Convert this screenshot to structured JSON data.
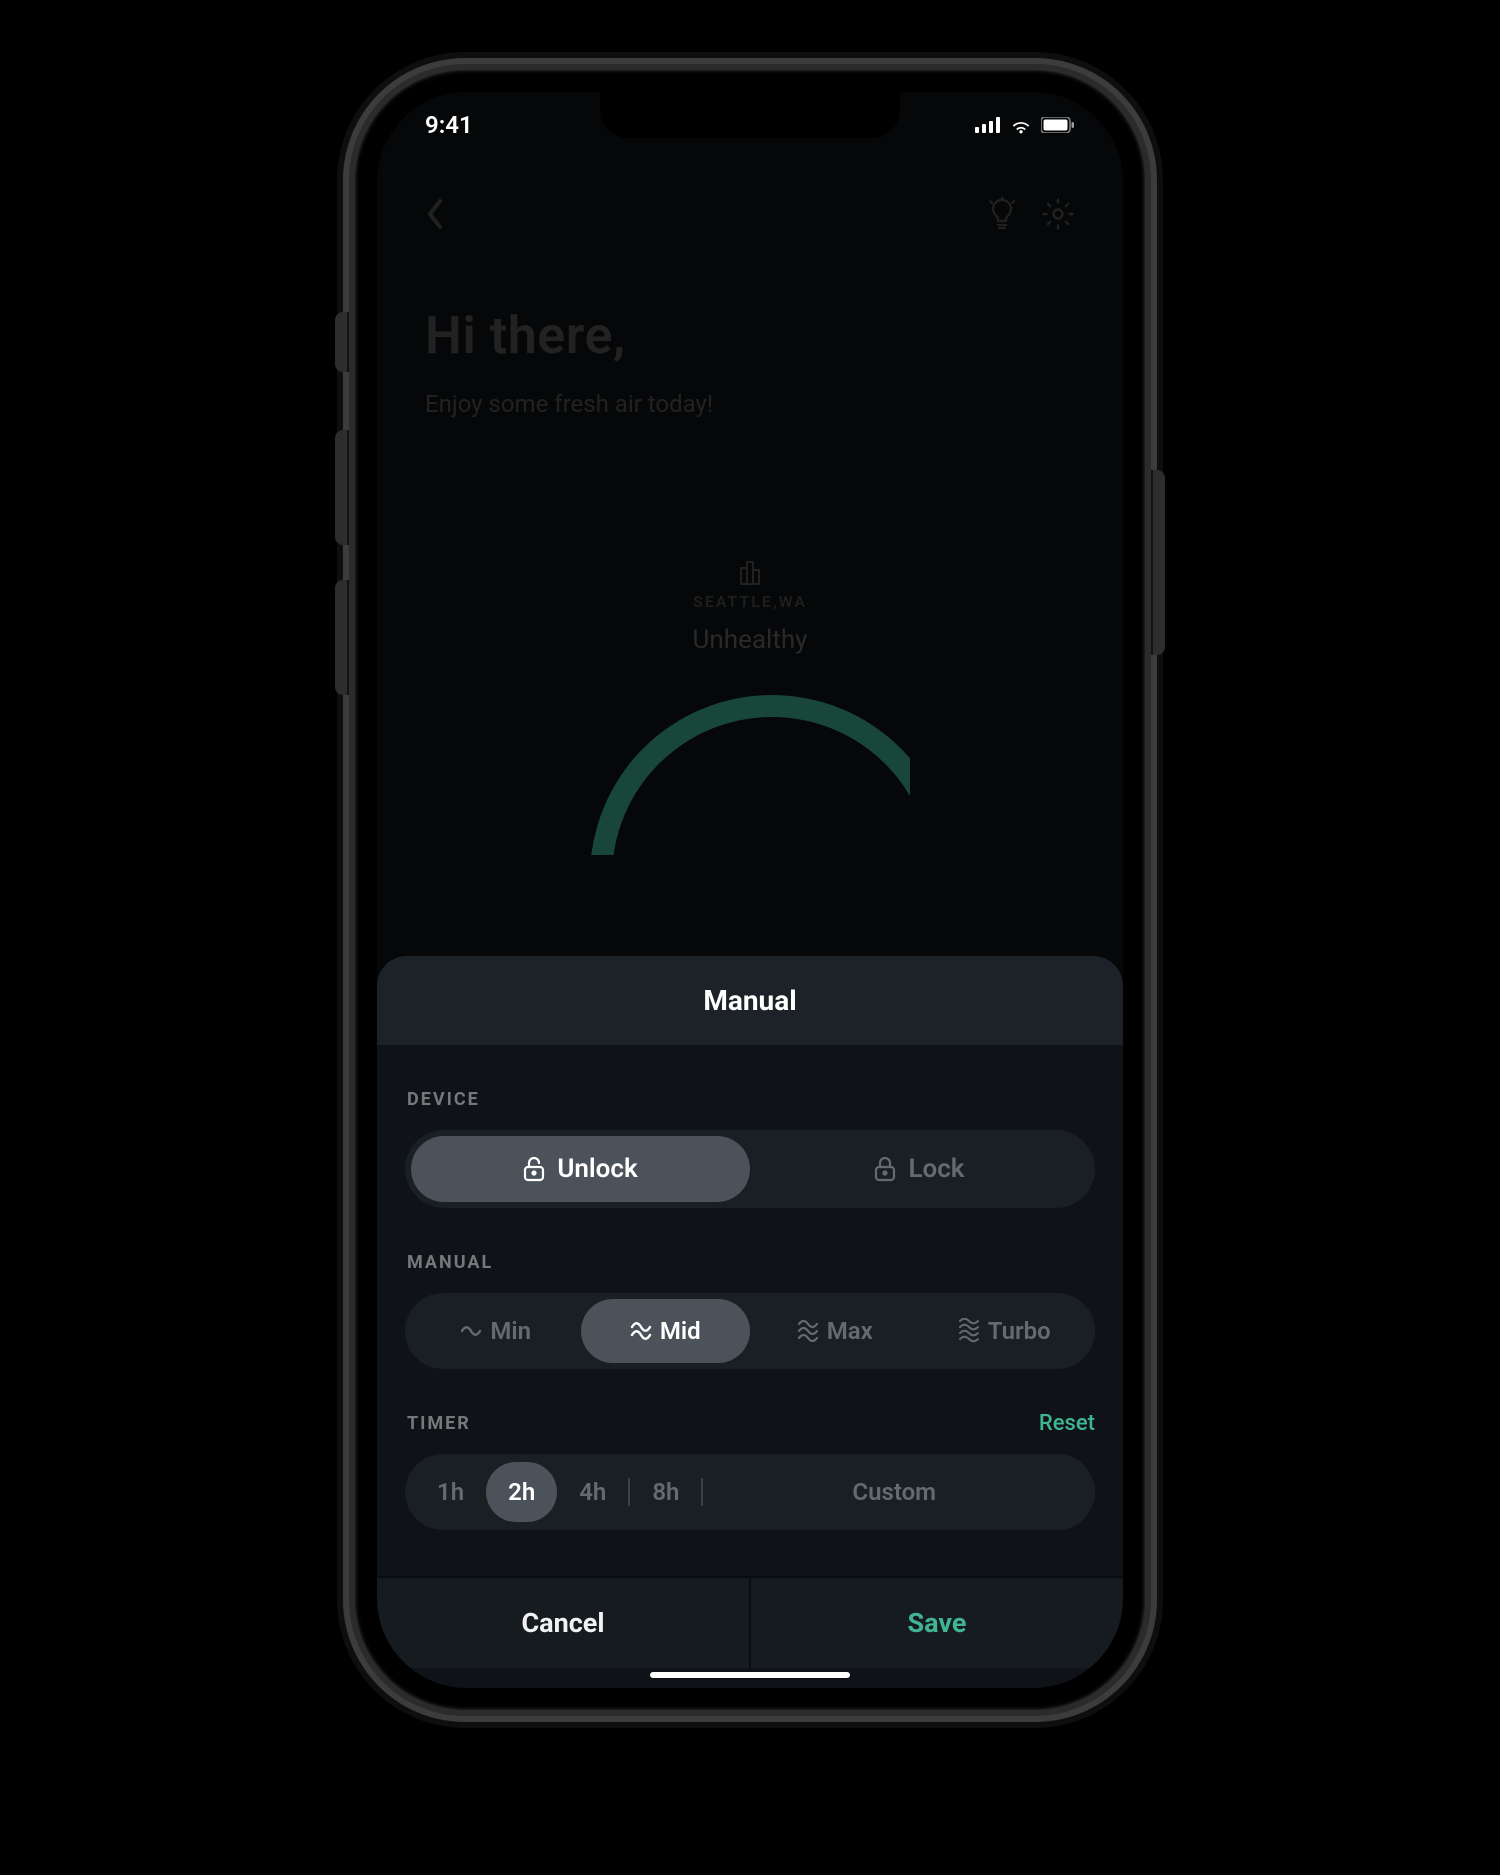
{
  "status": {
    "time": "9:41"
  },
  "header": {
    "greeting": "Hi there,",
    "subline": "Enjoy some fresh air today!",
    "location": "SEATTLE,WA",
    "air_status": "Unhealthy"
  },
  "sheet": {
    "title": "Manual",
    "device": {
      "label": "DEVICE",
      "options": {
        "unlock": "Unlock",
        "lock": "Lock"
      }
    },
    "manual": {
      "label": "MANUAL",
      "options": {
        "min": "Min",
        "mid": "Mid",
        "max": "Max",
        "turbo": "Turbo"
      }
    },
    "timer": {
      "label": "TIMER",
      "reset": "Reset",
      "options": {
        "h1": "1h",
        "h2": "2h",
        "h4": "4h",
        "h8": "8h",
        "custom": "Custom"
      }
    },
    "actions": {
      "cancel": "Cancel",
      "save": "Save"
    }
  },
  "colors": {
    "accent": "#3fb592"
  }
}
